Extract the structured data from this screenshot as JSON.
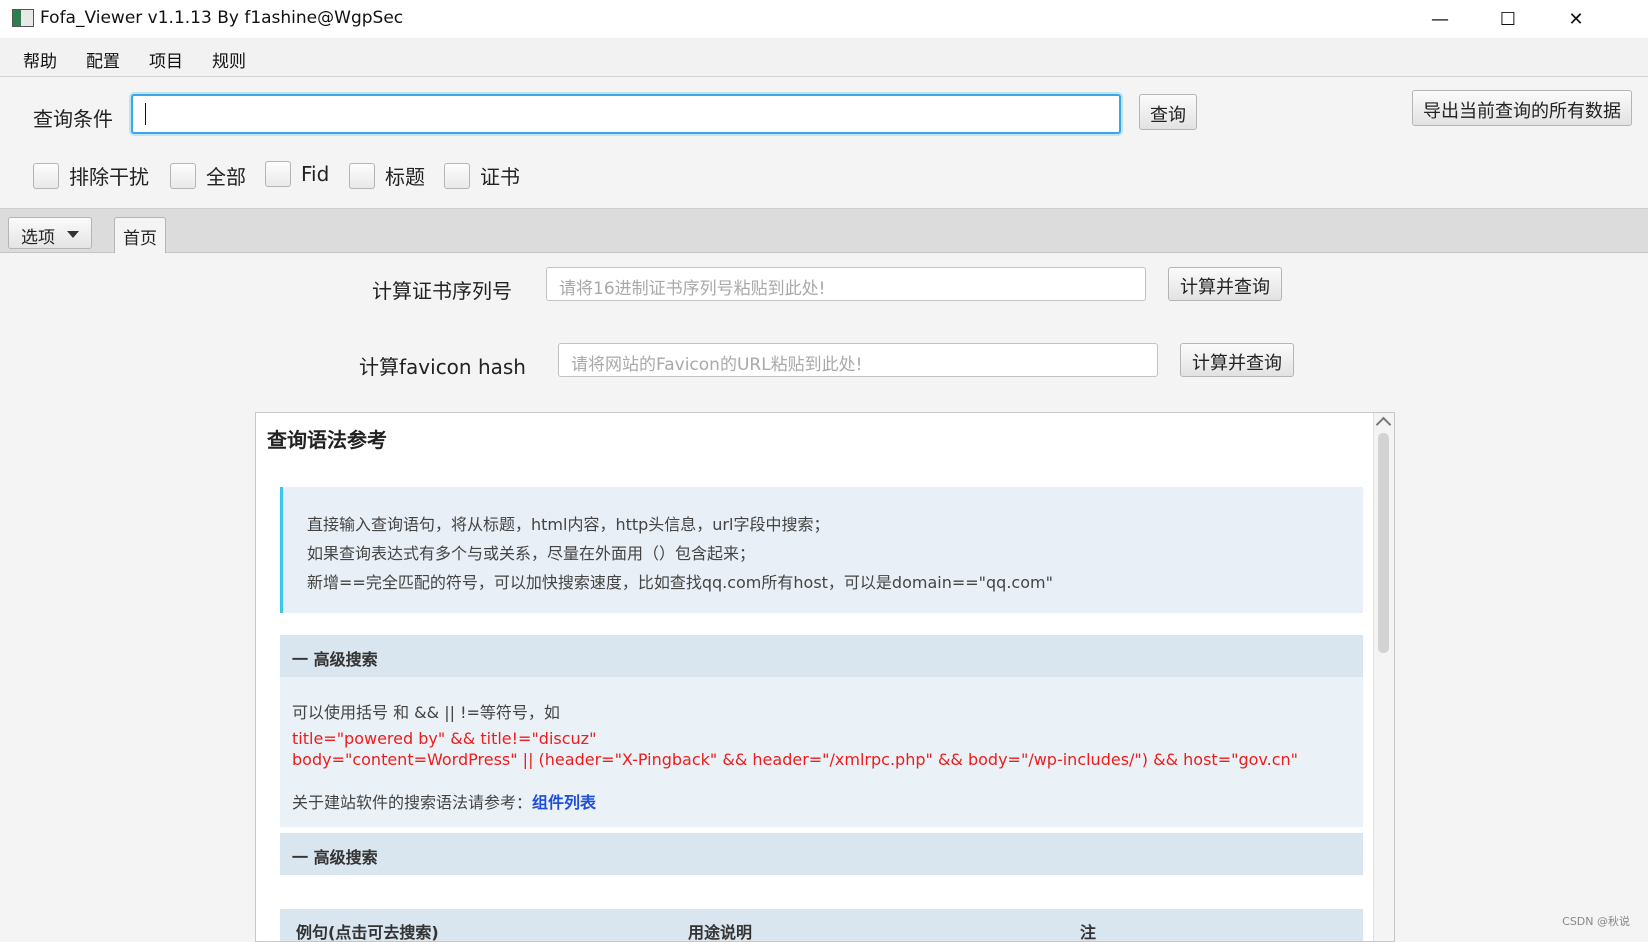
{
  "window": {
    "title": "Fofa_Viewer v1.1.13 By f1ashine@WgpSec",
    "minimize_glyph": "—",
    "maximize_glyph": "☐",
    "close_glyph": "✕"
  },
  "menu": [
    "帮助",
    "配置",
    "项目",
    "规则"
  ],
  "toolbar": {
    "query_label": "查询条件",
    "query_value": "",
    "query_button": "查询",
    "export_button": "导出当前查询的所有数据",
    "checkboxes": [
      {
        "label": "排除干扰",
        "checked": false
      },
      {
        "label": "全部",
        "checked": false
      },
      {
        "label": "Fid",
        "checked": false
      },
      {
        "label": "标题",
        "checked": false
      },
      {
        "label": "证书",
        "checked": false
      }
    ]
  },
  "tabs": {
    "options_label": "选项",
    "home_tab": "首页"
  },
  "home": {
    "cert_label": "计算证书序列号",
    "cert_placeholder": "请将16进制证书序列号粘贴到此处!",
    "cert_button": "计算并查询",
    "favicon_label": "计算favicon hash",
    "favicon_placeholder": "请将网站的Favicon的URL粘贴到此处!",
    "favicon_button": "计算并查询"
  },
  "reference": {
    "title": "查询语法参考",
    "notes": [
      "直接输入查询语句，将从标题，html内容，http头信息，url字段中搜索；",
      "如果查询表达式有多个与或关系，尽量在外面用（）包含起来；",
      "新增==完全匹配的符号，可以加快搜索速度，比如查找qq.com所有host，可以是domain==\"qq.com\""
    ],
    "section1_title": "一  高级搜索",
    "section1_intro": "可以使用括号 和 && || !=等符号，如",
    "example1": "title=\"powered by\" && title!=\"discuz\"",
    "example2": "body=\"content=WordPress\" || (header=\"X-Pingback\" && header=\"/xmlrpc.php\" && body=\"/wp-includes/\") && host=\"gov.cn\"",
    "ref_prefix": "关于建站软件的搜索语法请参考：",
    "ref_link": "组件列表",
    "section2_title": "一  高级搜索",
    "table_headers": [
      "例句(点击可去搜索)",
      "用途说明",
      "注"
    ]
  },
  "watermark": "CSDN @秋说",
  "colors": {
    "focus_border": "#3aa7e8",
    "note_accent": "#39c6ea",
    "example_red": "#ef1c1c",
    "link_blue": "#1f4fd8"
  }
}
